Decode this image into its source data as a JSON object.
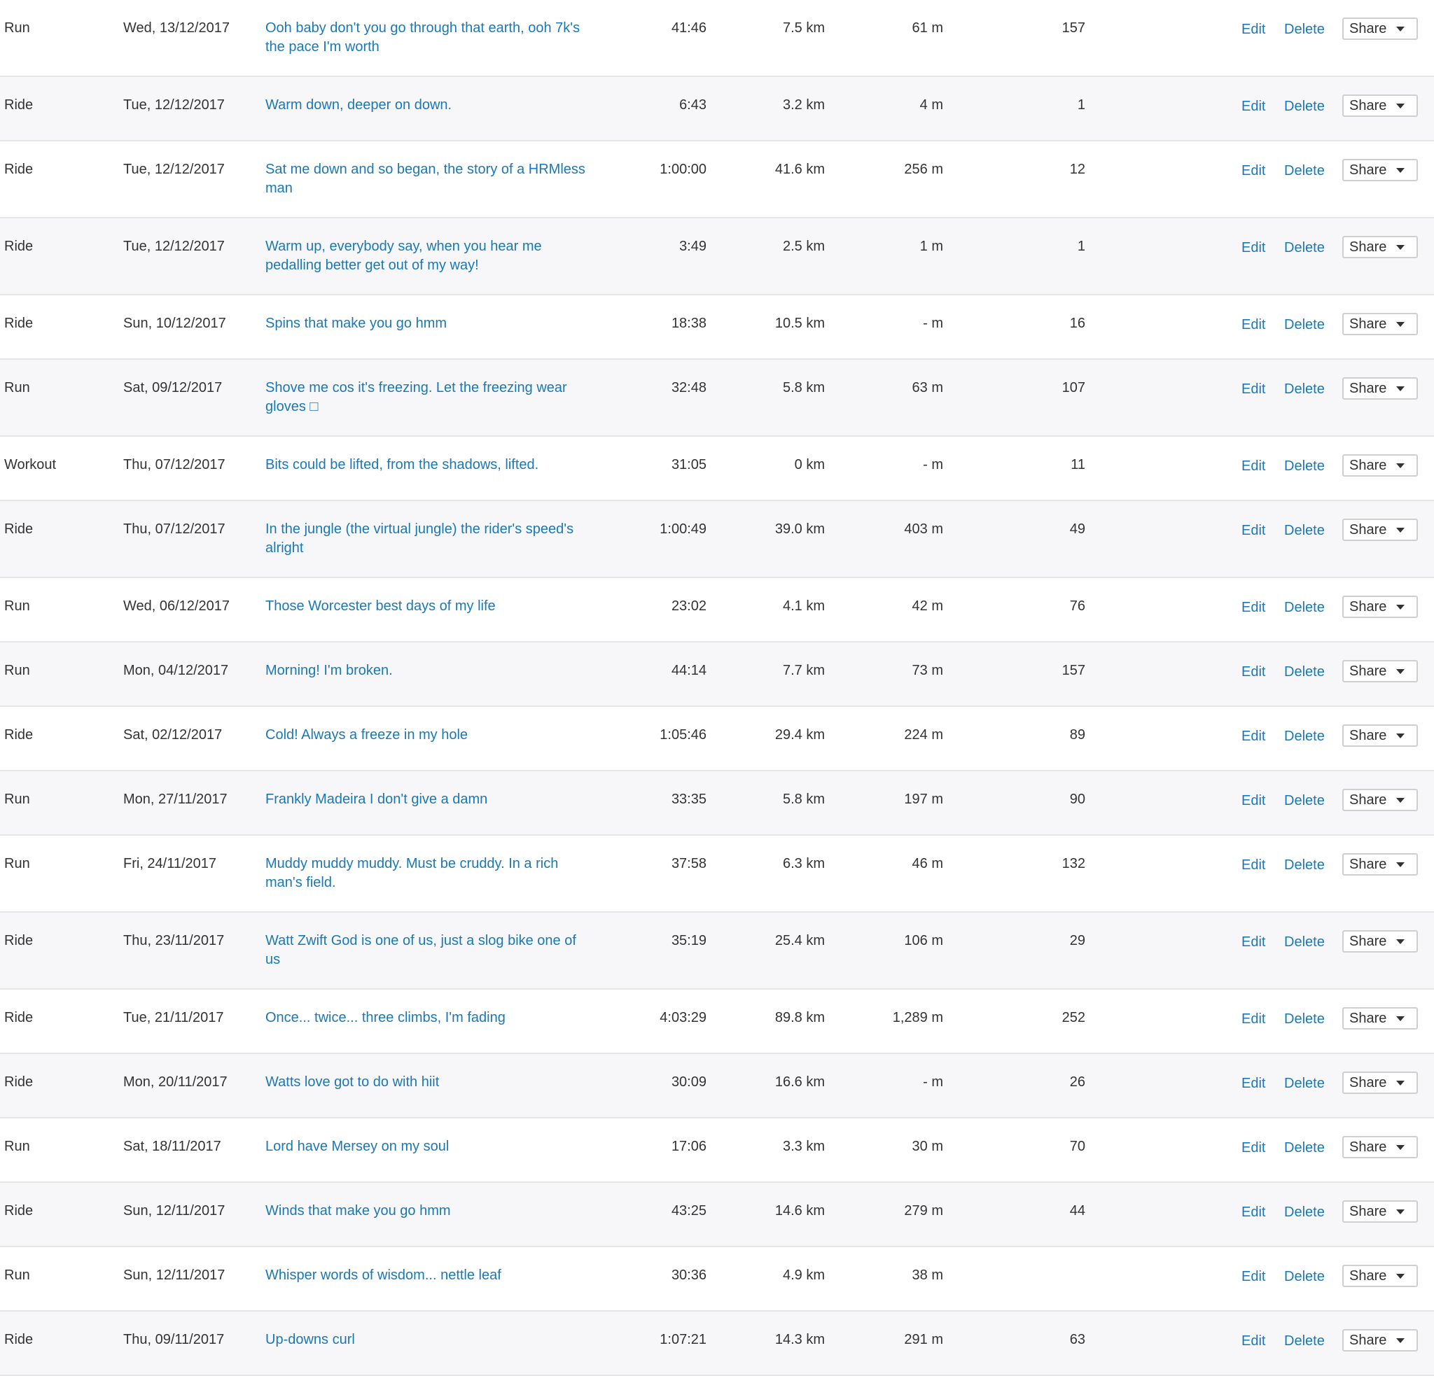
{
  "labels": {
    "edit": "Edit",
    "delete": "Delete",
    "share": "Share"
  },
  "colors": {
    "link": "#1a78b7",
    "text": "#333333",
    "row_alt": "#f7f7fa",
    "divider": "#e6e6e6"
  },
  "activities": [
    {
      "type": "Run",
      "date": "Wed, 13/12/2017",
      "title": "Ooh baby don't you go through that earth, ooh 7k's the pace I'm worth",
      "time": "41:46",
      "distance": "7.5 km",
      "elevation": "61 m",
      "count": "157"
    },
    {
      "type": "Ride",
      "date": "Tue, 12/12/2017",
      "title": "Warm down, deeper on down.",
      "time": "6:43",
      "distance": "3.2 km",
      "elevation": "4 m",
      "count": "1"
    },
    {
      "type": "Ride",
      "date": "Tue, 12/12/2017",
      "title": "Sat me down and so began, the story of a HRMless man",
      "time": "1:00:00",
      "distance": "41.6 km",
      "elevation": "256 m",
      "count": "12"
    },
    {
      "type": "Ride",
      "date": "Tue, 12/12/2017",
      "title": "Warm up, everybody say, when you hear me pedalling better get out of my way!",
      "time": "3:49",
      "distance": "2.5 km",
      "elevation": "1 m",
      "count": "1"
    },
    {
      "type": "Ride",
      "date": "Sun, 10/12/2017",
      "title": "Spins that make you go hmm",
      "time": "18:38",
      "distance": "10.5 km",
      "elevation": "- m",
      "count": "16"
    },
    {
      "type": "Run",
      "date": "Sat, 09/12/2017",
      "title": "Shove me cos it's freezing. Let the freezing wear gloves □",
      "time": "32:48",
      "distance": "5.8 km",
      "elevation": "63 m",
      "count": "107"
    },
    {
      "type": "Workout",
      "date": "Thu, 07/12/2017",
      "title": "Bits could be lifted, from the shadows, lifted.",
      "time": "31:05",
      "distance": "0 km",
      "elevation": "- m",
      "count": "11"
    },
    {
      "type": "Ride",
      "date": "Thu, 07/12/2017",
      "title": "In the jungle (the virtual jungle) the rider's speed's alright",
      "time": "1:00:49",
      "distance": "39.0 km",
      "elevation": "403 m",
      "count": "49"
    },
    {
      "type": "Run",
      "date": "Wed, 06/12/2017",
      "title": "Those Worcester best days of my life",
      "time": "23:02",
      "distance": "4.1 km",
      "elevation": "42 m",
      "count": "76"
    },
    {
      "type": "Run",
      "date": "Mon, 04/12/2017",
      "title": "Morning! I'm broken.",
      "time": "44:14",
      "distance": "7.7 km",
      "elevation": "73 m",
      "count": "157"
    },
    {
      "type": "Ride",
      "date": "Sat, 02/12/2017",
      "title": "Cold! Always a freeze in my hole",
      "time": "1:05:46",
      "distance": "29.4 km",
      "elevation": "224 m",
      "count": "89"
    },
    {
      "type": "Run",
      "date": "Mon, 27/11/2017",
      "title": "Frankly Madeira I don't give a damn",
      "time": "33:35",
      "distance": "5.8 km",
      "elevation": "197 m",
      "count": "90"
    },
    {
      "type": "Run",
      "date": "Fri, 24/11/2017",
      "title": "Muddy muddy muddy. Must be cruddy. In a rich man's field.",
      "time": "37:58",
      "distance": "6.3 km",
      "elevation": "46 m",
      "count": "132"
    },
    {
      "type": "Ride",
      "date": "Thu, 23/11/2017",
      "title": "Watt Zwift God is one of us, just a slog bike one of us",
      "time": "35:19",
      "distance": "25.4 km",
      "elevation": "106 m",
      "count": "29"
    },
    {
      "type": "Ride",
      "date": "Tue, 21/11/2017",
      "title": "Once... twice... three climbs, I'm fading",
      "time": "4:03:29",
      "distance": "89.8 km",
      "elevation": "1,289 m",
      "count": "252"
    },
    {
      "type": "Ride",
      "date": "Mon, 20/11/2017",
      "title": "Watts love got to do with hiit",
      "time": "30:09",
      "distance": "16.6 km",
      "elevation": "- m",
      "count": "26"
    },
    {
      "type": "Run",
      "date": "Sat, 18/11/2017",
      "title": "Lord have Mersey on my soul",
      "time": "17:06",
      "distance": "3.3 km",
      "elevation": "30 m",
      "count": "70"
    },
    {
      "type": "Ride",
      "date": "Sun, 12/11/2017",
      "title": "Winds that make you go hmm",
      "time": "43:25",
      "distance": "14.6 km",
      "elevation": "279 m",
      "count": "44"
    },
    {
      "type": "Run",
      "date": "Sun, 12/11/2017",
      "title": "Whisper words of wisdom... nettle leaf",
      "time": "30:36",
      "distance": "4.9 km",
      "elevation": "38 m",
      "count": ""
    },
    {
      "type": "Ride",
      "date": "Thu, 09/11/2017",
      "title": "Up-downs curl",
      "time": "1:07:21",
      "distance": "14.3 km",
      "elevation": "291 m",
      "count": "63"
    }
  ]
}
